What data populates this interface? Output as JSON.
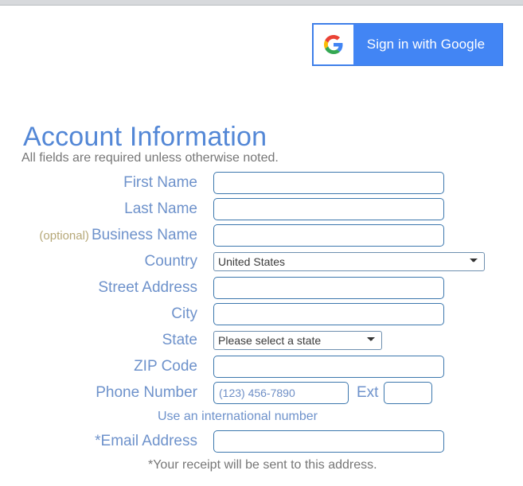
{
  "browser": {
    "chrome_bar_color": "#d7d9dc"
  },
  "google_button": {
    "label": "Sign in with Google",
    "background_color": "#4285F4",
    "logo_icon": "google-g-icon"
  },
  "heading": {
    "title": "Account Information",
    "title_color": "#5387d6",
    "note": "All fields are required unless otherwise noted."
  },
  "form": {
    "fields": {
      "first_name": {
        "label": "First Name",
        "value": "",
        "placeholder": ""
      },
      "last_name": {
        "label": "Last Name",
        "value": "",
        "placeholder": ""
      },
      "business_name": {
        "optional_tag": "(optional)",
        "label": "Business Name",
        "value": "",
        "placeholder": ""
      },
      "country": {
        "label": "Country",
        "selected": "United States"
      },
      "street_address": {
        "label": "Street Address",
        "value": "",
        "placeholder": ""
      },
      "city": {
        "label": "City",
        "value": "",
        "placeholder": ""
      },
      "state": {
        "label": "State",
        "selected": "Please select a state"
      },
      "zip_code": {
        "label": "ZIP Code",
        "value": "",
        "placeholder": ""
      },
      "phone_number": {
        "label": "Phone Number",
        "value": "",
        "placeholder": "(123) 456-7890"
      },
      "extension": {
        "label": "Ext",
        "value": "",
        "placeholder": ""
      },
      "email_address": {
        "label": "*Email Address",
        "value": "",
        "placeholder": ""
      }
    },
    "links": {
      "international_number": "Use an international number"
    },
    "notes": {
      "receipt": "*Your receipt will be sent to this address."
    },
    "colors": {
      "label": "#6e92cb",
      "optional_tag": "#b6a878",
      "input_border": "#3c77ad",
      "note_text": "#767676"
    }
  }
}
